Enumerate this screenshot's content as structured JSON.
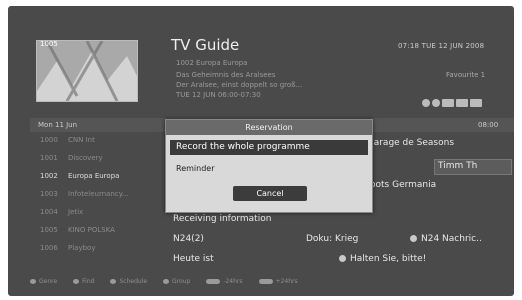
{
  "header": {
    "channel_number": "1005",
    "title": "TV Guide",
    "clock": "07:18 TUE 12 JUN 2008",
    "favorite": "Favourite 1",
    "info_lines": [
      "1002   Europa Europa",
      "Das Geheimnis des Aralsees",
      "Der Aralsee, einst doppelt so groß...",
      "TUE 12 JUN  06:00-07:30"
    ]
  },
  "date_bar": {
    "date": "Mon 11 Jun",
    "time_right": "08:00"
  },
  "channels": [
    {
      "num": "1000",
      "name": "CNN Int"
    },
    {
      "num": "1001",
      "name": "Discovery"
    },
    {
      "num": "1002",
      "name": "Europa Europa"
    },
    {
      "num": "1003",
      "name": "Infoteleurnancy..."
    },
    {
      "num": "1004",
      "name": "Jetix"
    },
    {
      "num": "1005",
      "name": "KINO POLSKA"
    },
    {
      "num": "1006",
      "name": "Playboy"
    }
  ],
  "programmes": {
    "row1": "garage de Seasons",
    "row2": "Timm Th",
    "row3": "oots Germania",
    "receiving": "Receiving information",
    "n24": "N24(2)",
    "doku": "Doku: Krieg",
    "n24_nachric": "N24 Nachric..",
    "heute": "Heute ist",
    "halten": "Halten Sie, bitte!"
  },
  "dialog": {
    "title": "Reservation",
    "option_record": "Record the whole programme",
    "option_reminder": "Reminder",
    "cancel": "Cancel"
  },
  "bottom_bar": [
    {
      "label": "Genre",
      "kind": "dot"
    },
    {
      "label": "Find",
      "kind": "dot"
    },
    {
      "label": "Schedule",
      "kind": "dot"
    },
    {
      "label": "Group",
      "kind": "dot"
    },
    {
      "label": "-24hrs",
      "kind": "pill"
    },
    {
      "label": "+24hrs",
      "kind": "pill"
    }
  ]
}
